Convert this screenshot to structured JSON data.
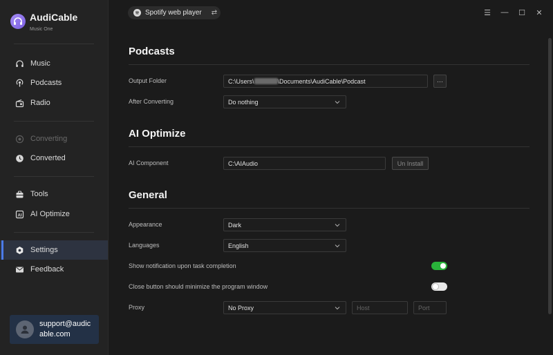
{
  "app": {
    "name": "AudiCable",
    "subtitle": "Music One"
  },
  "sidebar": {
    "items": [
      {
        "label": "Music",
        "icon": "headphones-icon"
      },
      {
        "label": "Podcasts",
        "icon": "podcast-icon"
      },
      {
        "label": "Radio",
        "icon": "radio-icon"
      },
      {
        "label": "Converting",
        "icon": "converting-icon"
      },
      {
        "label": "Converted",
        "icon": "clock-icon"
      },
      {
        "label": "Tools",
        "icon": "tools-icon"
      },
      {
        "label": "AI Optimize",
        "icon": "ai-icon"
      },
      {
        "label": "Settings",
        "icon": "gear-icon"
      },
      {
        "label": "Feedback",
        "icon": "mail-icon"
      }
    ],
    "user": {
      "email": "support@audicable.com"
    }
  },
  "header": {
    "source": "Spotify web player",
    "swap_symbol": "⇄",
    "window_controls": [
      "☰",
      "—",
      "☐",
      "✕"
    ]
  },
  "podcasts": {
    "title": "Podcasts",
    "output_folder_label": "Output Folder",
    "output_folder_prefix": "C:\\Users\\",
    "output_folder_suffix": "\\Documents\\AudiCable\\Podcast",
    "browse_label": "···",
    "after_converting_label": "After Converting",
    "after_converting_value": "Do nothing"
  },
  "ai_optimize": {
    "title": "AI Optimize",
    "component_label": "AI Component",
    "component_value": "C:\\AIAudio",
    "uninstall_label": "Un Install"
  },
  "general": {
    "title": "General",
    "appearance_label": "Appearance",
    "appearance_value": "Dark",
    "languages_label": "Languages",
    "languages_value": "English",
    "notification_label": "Show notification upon task completion",
    "notification_on": true,
    "minimize_label": "Close button should minimize the program window",
    "minimize_on": false,
    "proxy_label": "Proxy",
    "proxy_value": "No Proxy",
    "host_placeholder": "Host",
    "port_placeholder": "Port"
  },
  "colors": {
    "accent": "#4b7bea",
    "toggle_on": "#29b33a",
    "user_card": "#233146"
  }
}
